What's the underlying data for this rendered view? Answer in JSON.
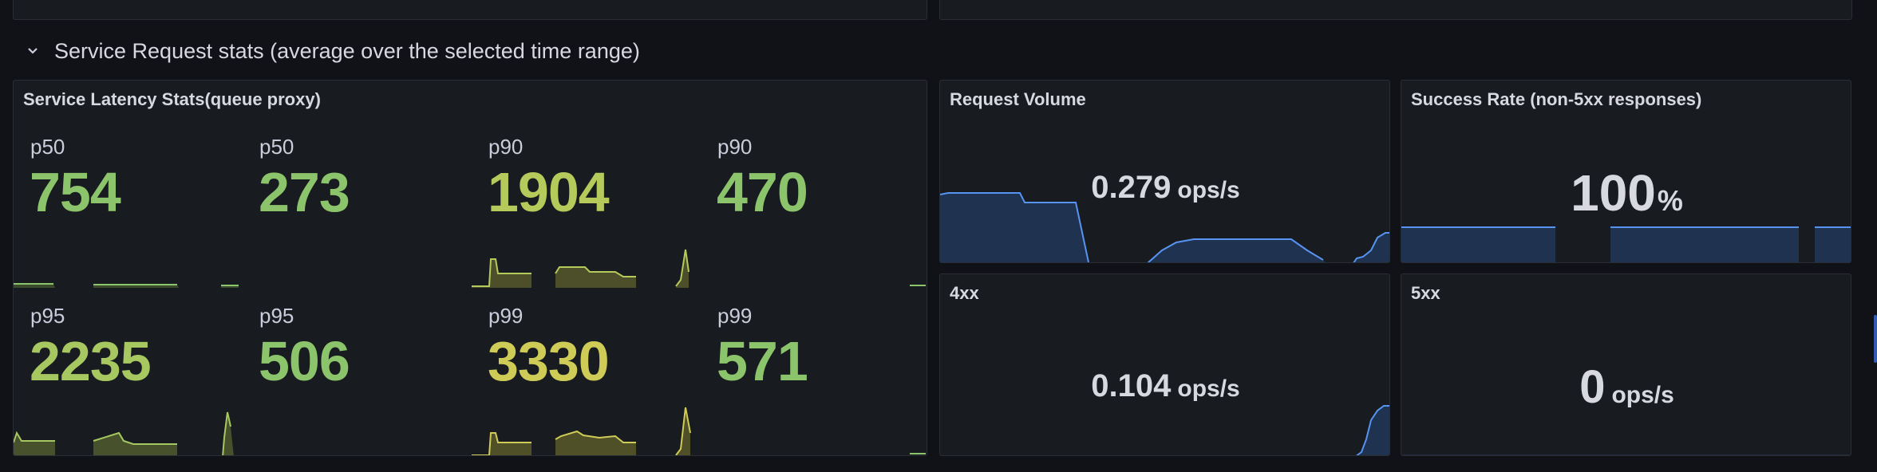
{
  "row": {
    "title": "Service Request stats (average over the selected time range)"
  },
  "colors": {
    "background": "#111217",
    "panel": "#181b1f",
    "green": "#73bf69",
    "lime": "#b0c85a",
    "yellow": "#cccc55",
    "blue": "#5794f2",
    "blue_fill": "#1f3350"
  },
  "latency_panel": {
    "title": "Service Latency Stats(queue proxy)",
    "stats": [
      {
        "label": "p50",
        "value": "754",
        "color": "#8cc46c"
      },
      {
        "label": "p50",
        "value": "273",
        "color": "#8cc46c"
      },
      {
        "label": "p90",
        "value": "1904",
        "color": "#b6c95b"
      },
      {
        "label": "p90",
        "value": "470",
        "color": "#8cc46c"
      },
      {
        "label": "p95",
        "value": "2235",
        "color": "#a7c760"
      },
      {
        "label": "p95",
        "value": "506",
        "color": "#8cc46c"
      },
      {
        "label": "p99",
        "value": "3330",
        "color": "#cfcb57"
      },
      {
        "label": "p99",
        "value": "571",
        "color": "#8cc46c"
      }
    ]
  },
  "request_volume": {
    "title": "Request Volume",
    "value": "0.279",
    "unit": "ops/s"
  },
  "success_rate": {
    "title": "Success Rate (non-5xx responses)",
    "value": "100",
    "unit": "%"
  },
  "four_xx": {
    "title": "4xx",
    "value": "0.104",
    "unit": "ops/s"
  },
  "five_xx": {
    "title": "5xx",
    "value": "0",
    "unit": "ops/s"
  }
}
